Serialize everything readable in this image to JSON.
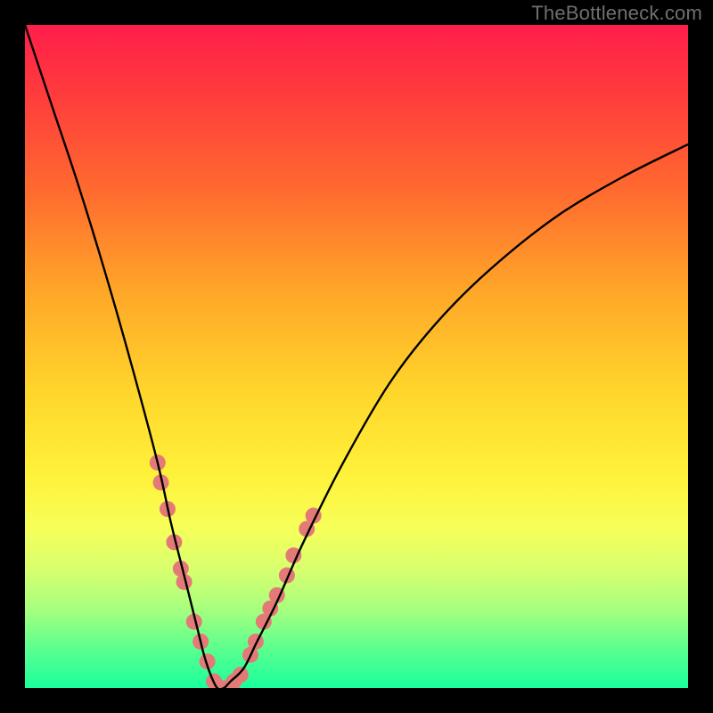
{
  "watermark": "TheBottleneck.com",
  "chart_data": {
    "type": "line",
    "title": "",
    "xlabel": "",
    "ylabel": "",
    "xlim": [
      0,
      100
    ],
    "ylim": [
      0,
      100
    ],
    "grid": false,
    "series": [
      {
        "name": "curve",
        "color": "#000000",
        "x": [
          0,
          4,
          8,
          12,
          16,
          20,
          22,
          24,
          26,
          27,
          28,
          29,
          30,
          31,
          33,
          35,
          38,
          42,
          48,
          55,
          62,
          70,
          80,
          90,
          100
        ],
        "y": [
          100,
          88,
          76,
          63,
          49,
          34,
          25,
          17,
          9,
          5,
          2,
          0,
          0,
          1,
          3,
          7,
          13,
          22,
          34,
          46,
          55,
          63,
          71,
          77,
          82
        ]
      }
    ],
    "highlights": {
      "name": "dots",
      "color": "#e47a78",
      "points": [
        {
          "x": 20.0,
          "y": 34
        },
        {
          "x": 20.5,
          "y": 31
        },
        {
          "x": 21.5,
          "y": 27
        },
        {
          "x": 22.5,
          "y": 22
        },
        {
          "x": 23.5,
          "y": 18
        },
        {
          "x": 24.0,
          "y": 16
        },
        {
          "x": 25.5,
          "y": 10
        },
        {
          "x": 26.5,
          "y": 7
        },
        {
          "x": 27.5,
          "y": 4
        },
        {
          "x": 28.5,
          "y": 1
        },
        {
          "x": 29.5,
          "y": 0
        },
        {
          "x": 30.5,
          "y": 0
        },
        {
          "x": 31.5,
          "y": 1
        },
        {
          "x": 32.5,
          "y": 2
        },
        {
          "x": 34.0,
          "y": 5
        },
        {
          "x": 34.8,
          "y": 7
        },
        {
          "x": 36.0,
          "y": 10
        },
        {
          "x": 37.0,
          "y": 12
        },
        {
          "x": 38.0,
          "y": 14
        },
        {
          "x": 39.5,
          "y": 17
        },
        {
          "x": 40.5,
          "y": 20
        },
        {
          "x": 42.5,
          "y": 24
        },
        {
          "x": 43.5,
          "y": 26
        }
      ]
    }
  }
}
